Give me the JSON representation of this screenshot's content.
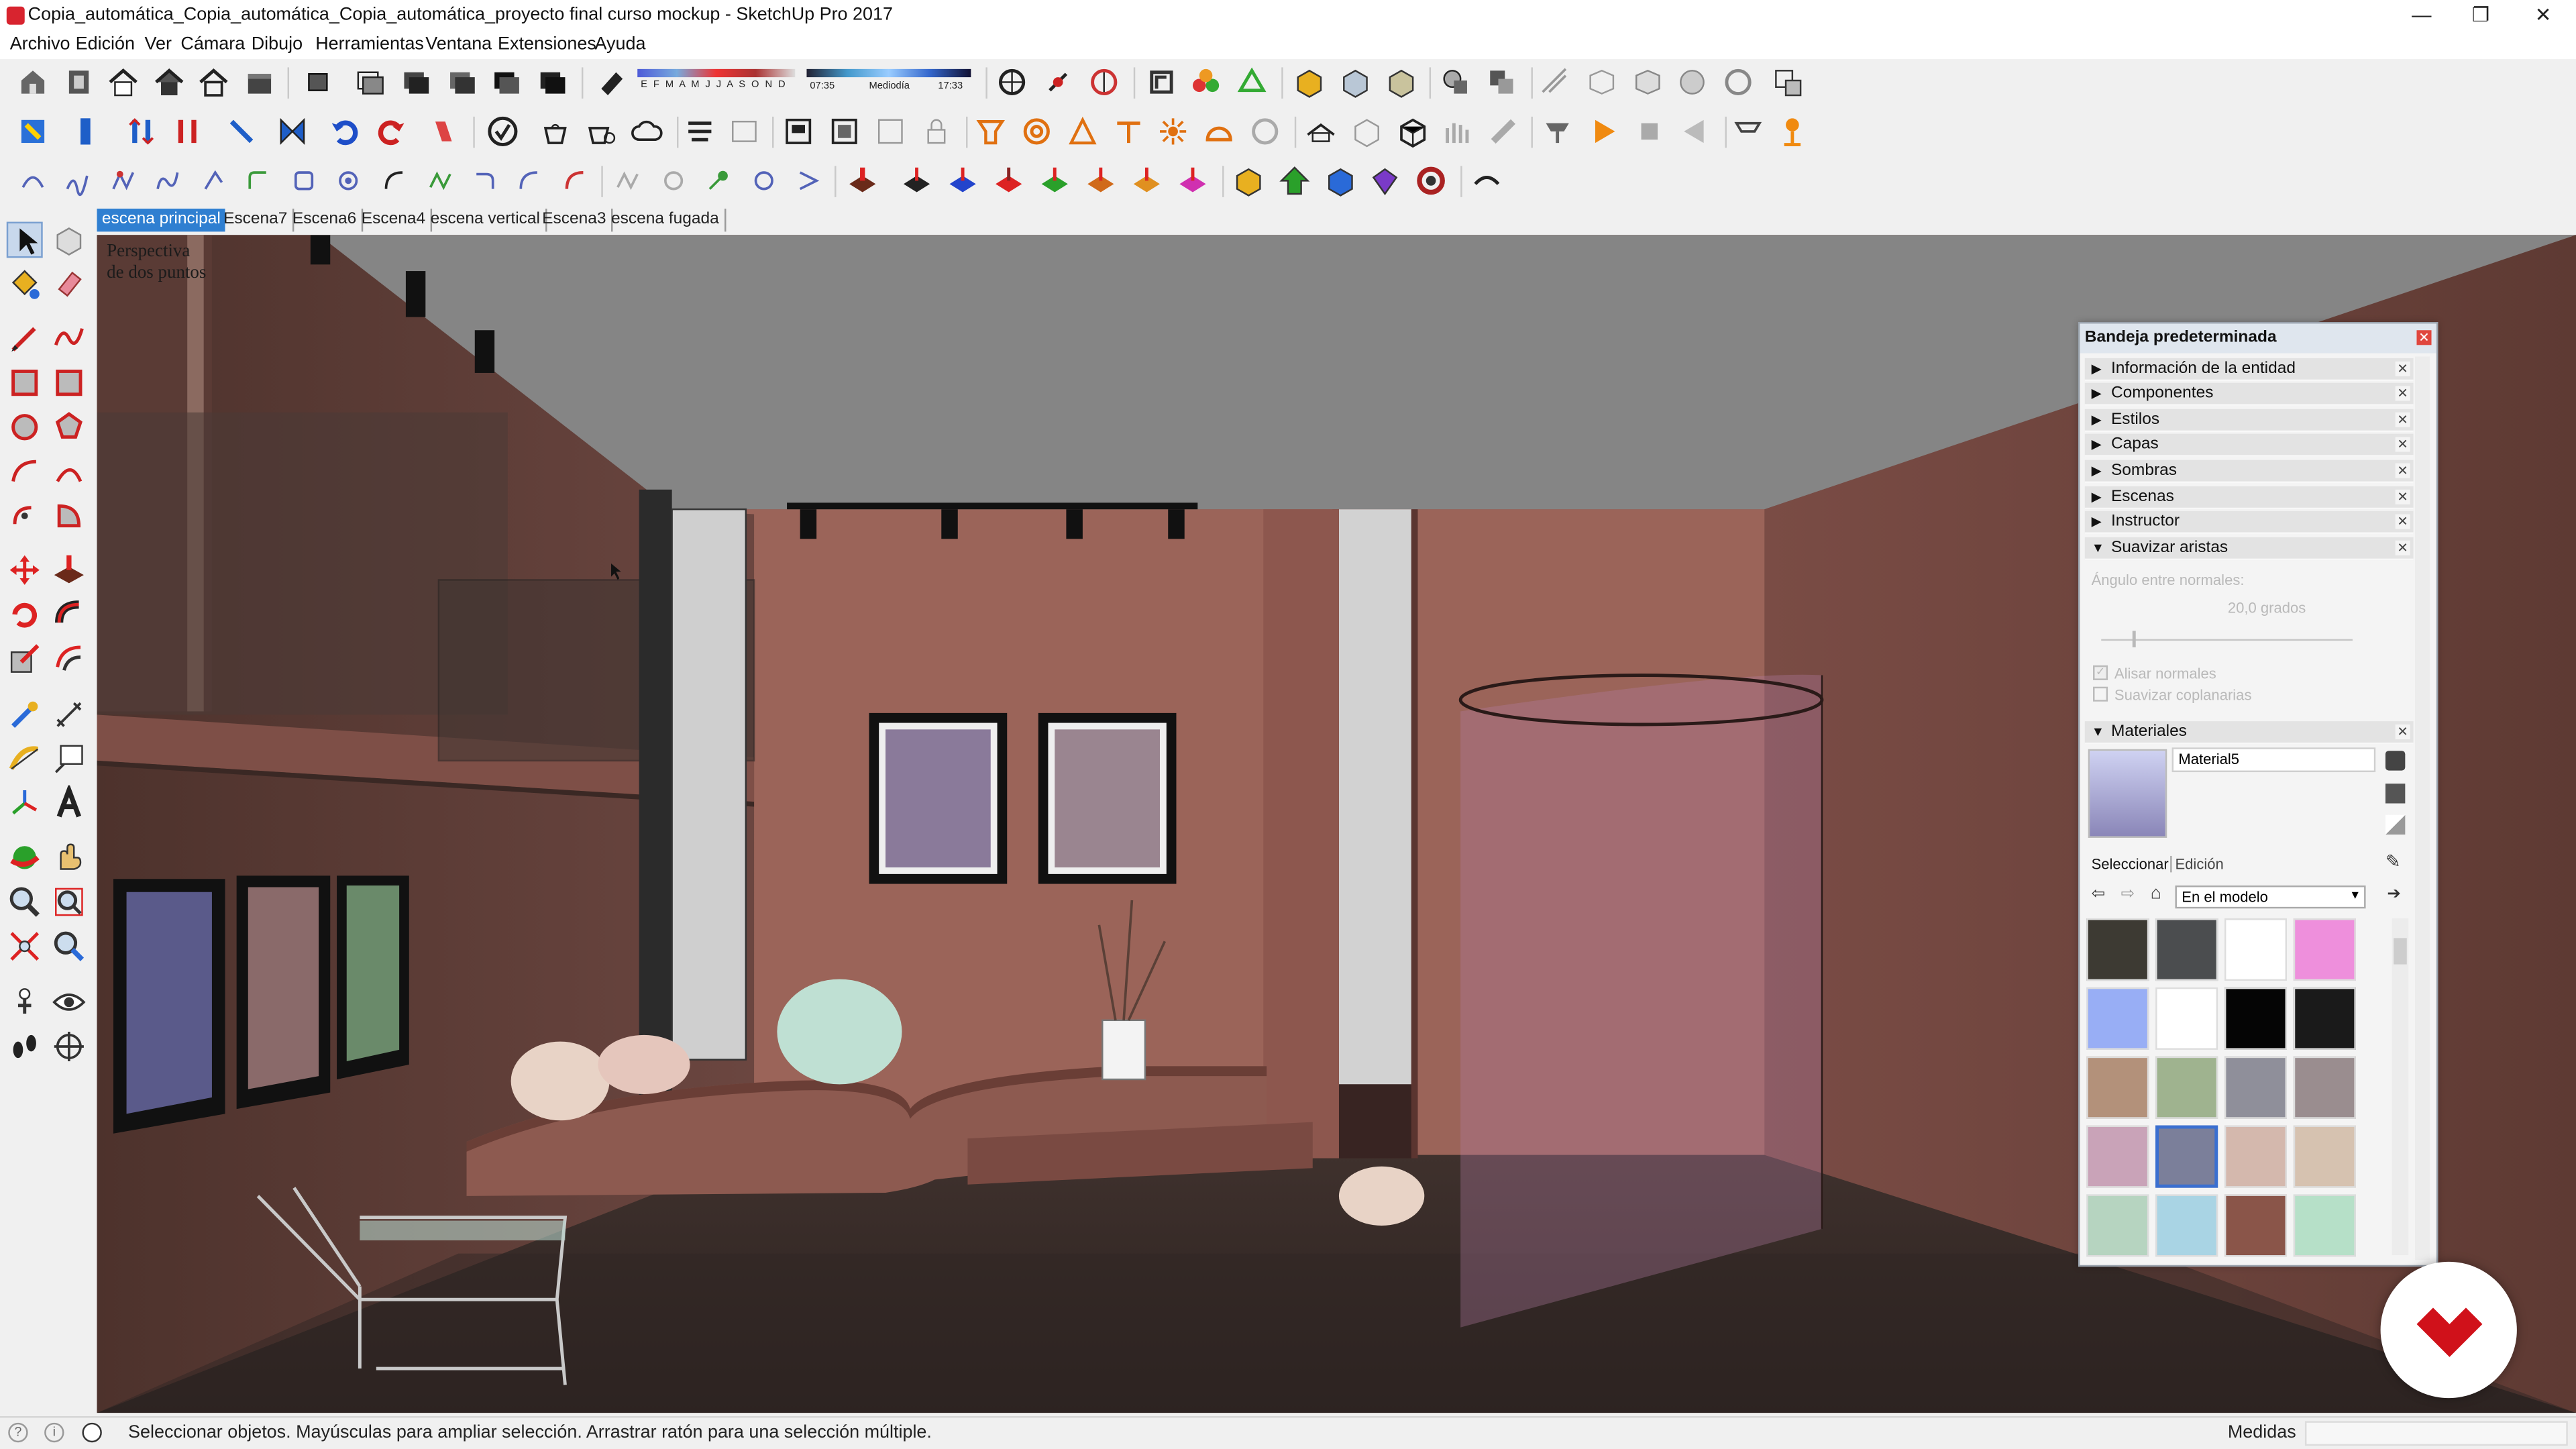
{
  "window": {
    "title": "Copia_automática_Copia_automática_Copia_automática_proyecto final curso mockup - SketchUp Pro 2017",
    "minimize": "—",
    "restore": "❐",
    "close": "✕"
  },
  "menu": [
    "Archivo",
    "Edición",
    "Ver",
    "Cámara",
    "Dibujo",
    "Herramientas",
    "Ventana",
    "Extensiones",
    "Ayuda"
  ],
  "shadow_widget": {
    "months": "E F M A M J J A S O N D",
    "time_start": "07:35",
    "time_mid": "Mediodía",
    "time_end": "17:33"
  },
  "scene_tabs": [
    "escena principal",
    "Escena7",
    "Escena6",
    "Escena4",
    "escena vertical",
    "Escena3",
    "escena fugada"
  ],
  "active_scene": 0,
  "viewport": {
    "camera_label": "Perspectiva\nde dos puntos"
  },
  "tray": {
    "title": "Bandeja predeterminada",
    "panels": [
      "Información de la entidad",
      "Componentes",
      "Estilos",
      "Capas",
      "Sombras",
      "Escenas",
      "Instructor",
      "Suavizar aristas"
    ],
    "soften": {
      "angle_label": "Ángulo entre normales:",
      "angle_value": "20,0 grados",
      "smooth_normals": "Alisar normales",
      "soften_coplanar": "Suavizar coplanarias"
    },
    "materials": {
      "header": "Materiales",
      "current_name": "Material5",
      "tab_select": "Seleccionar",
      "tab_edit": "Edición",
      "collection": "En el modelo",
      "swatches": [
        "#3d3a33",
        "#4b4d4f",
        "#ffffff",
        "#ee8fdc",
        "#98aef5",
        "#ffffff",
        "#050505",
        "#1a1a1a",
        "#b3917a",
        "#9fb38f",
        "#8f8f9a",
        "#9a8d8f",
        "#c9a3b8",
        "#7b7f9a",
        "#d4b8ad",
        "#d6c2b0",
        "#b6d4c0",
        "#a9d4e4",
        "#8a5549",
        "#b6e0c8"
      ]
    }
  },
  "status": {
    "message": "Seleccionar objetos. Mayúsculas para ampliar selección. Arrastrar ratón para una selección múltiple.",
    "measures_label": "Medidas",
    "measures_value": ""
  }
}
